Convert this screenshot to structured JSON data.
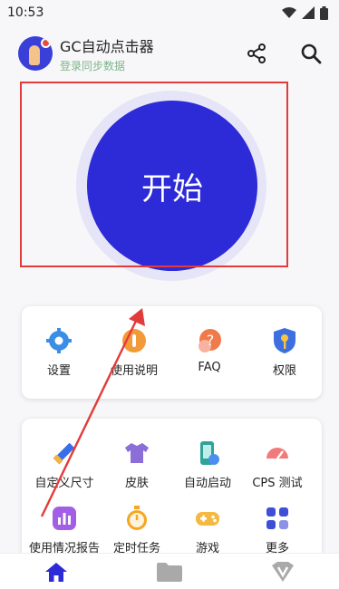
{
  "status_bar": {
    "time": "10:53"
  },
  "header": {
    "title": "GC自动点击器",
    "subtitle": "登录同步数据"
  },
  "start": {
    "label": "开始"
  },
  "quick_menu": [
    {
      "label": "设置",
      "icon": "gear-icon"
    },
    {
      "label": "使用说明",
      "icon": "instructions-icon"
    },
    {
      "label": "FAQ",
      "icon": "question-icon"
    },
    {
      "label": "权限",
      "icon": "shield-key-icon"
    }
  ],
  "tools_menu": [
    {
      "label": "自定义尺寸",
      "icon": "ruler-pencil-icon"
    },
    {
      "label": "皮肤",
      "icon": "shirt-icon"
    },
    {
      "label": "自动启动",
      "icon": "phone-auto-icon"
    },
    {
      "label": "CPS 测试",
      "icon": "speedometer-icon"
    },
    {
      "label": "使用情况报告",
      "icon": "bar-chart-icon"
    },
    {
      "label": "定时任务",
      "icon": "stopwatch-icon"
    },
    {
      "label": "游戏",
      "icon": "gamepad-icon"
    },
    {
      "label": "更多",
      "icon": "grid-more-icon"
    }
  ],
  "colors": {
    "accent": "#2d2ad8",
    "highlight": "#e23b3b",
    "nav_active": "#2d2ad8"
  }
}
